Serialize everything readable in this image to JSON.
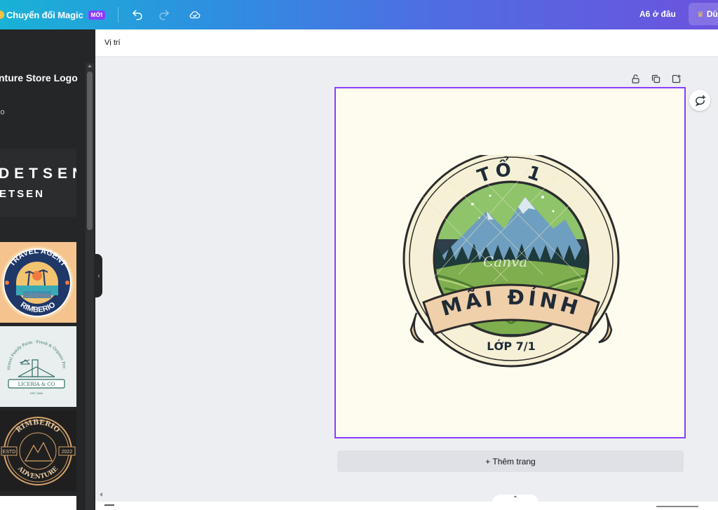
{
  "topbar": {
    "magic_label": "Chuyển đổi Magic",
    "new_badge": "MỚI",
    "link_text": "A6 ở đâu",
    "share_label": "Dù",
    "icons": [
      "undo-icon",
      "redo-icon",
      "cloud-check-icon",
      "crown-icon"
    ]
  },
  "left_panel": {
    "title": "nture Store Logo",
    "subtitle": "lo",
    "templates": [
      {
        "line1": "DETSEN",
        "line2": "ETSEN"
      },
      {
        "arc_top": "TRAVEL AGENT",
        "script": "California",
        "arc_bottom": "RIMBERIO"
      },
      {
        "arc_top": "Traditional Family Farm · Fresh & Organic Products",
        "banner": "LICERIA & CO",
        "est": "EST 1996"
      },
      {
        "arc_top": "RIMBERIO",
        "left": "ESTD",
        "right": "2022",
        "arc_bottom": "ADVENTURE"
      }
    ]
  },
  "position_bar": {
    "label": "Vị trí"
  },
  "canvas": {
    "logo_top": "TỔ 1",
    "logo_banner": "MÃI ĐỈNH",
    "logo_bottom": "LỚP 7/1",
    "watermark": "Canva",
    "border_color": "#8b3dff",
    "background": "#fdfcef"
  },
  "page_controls": [
    "lock-icon",
    "duplicate-icon",
    "add-page-icon"
  ],
  "add_page_label": "+ Thêm trang"
}
